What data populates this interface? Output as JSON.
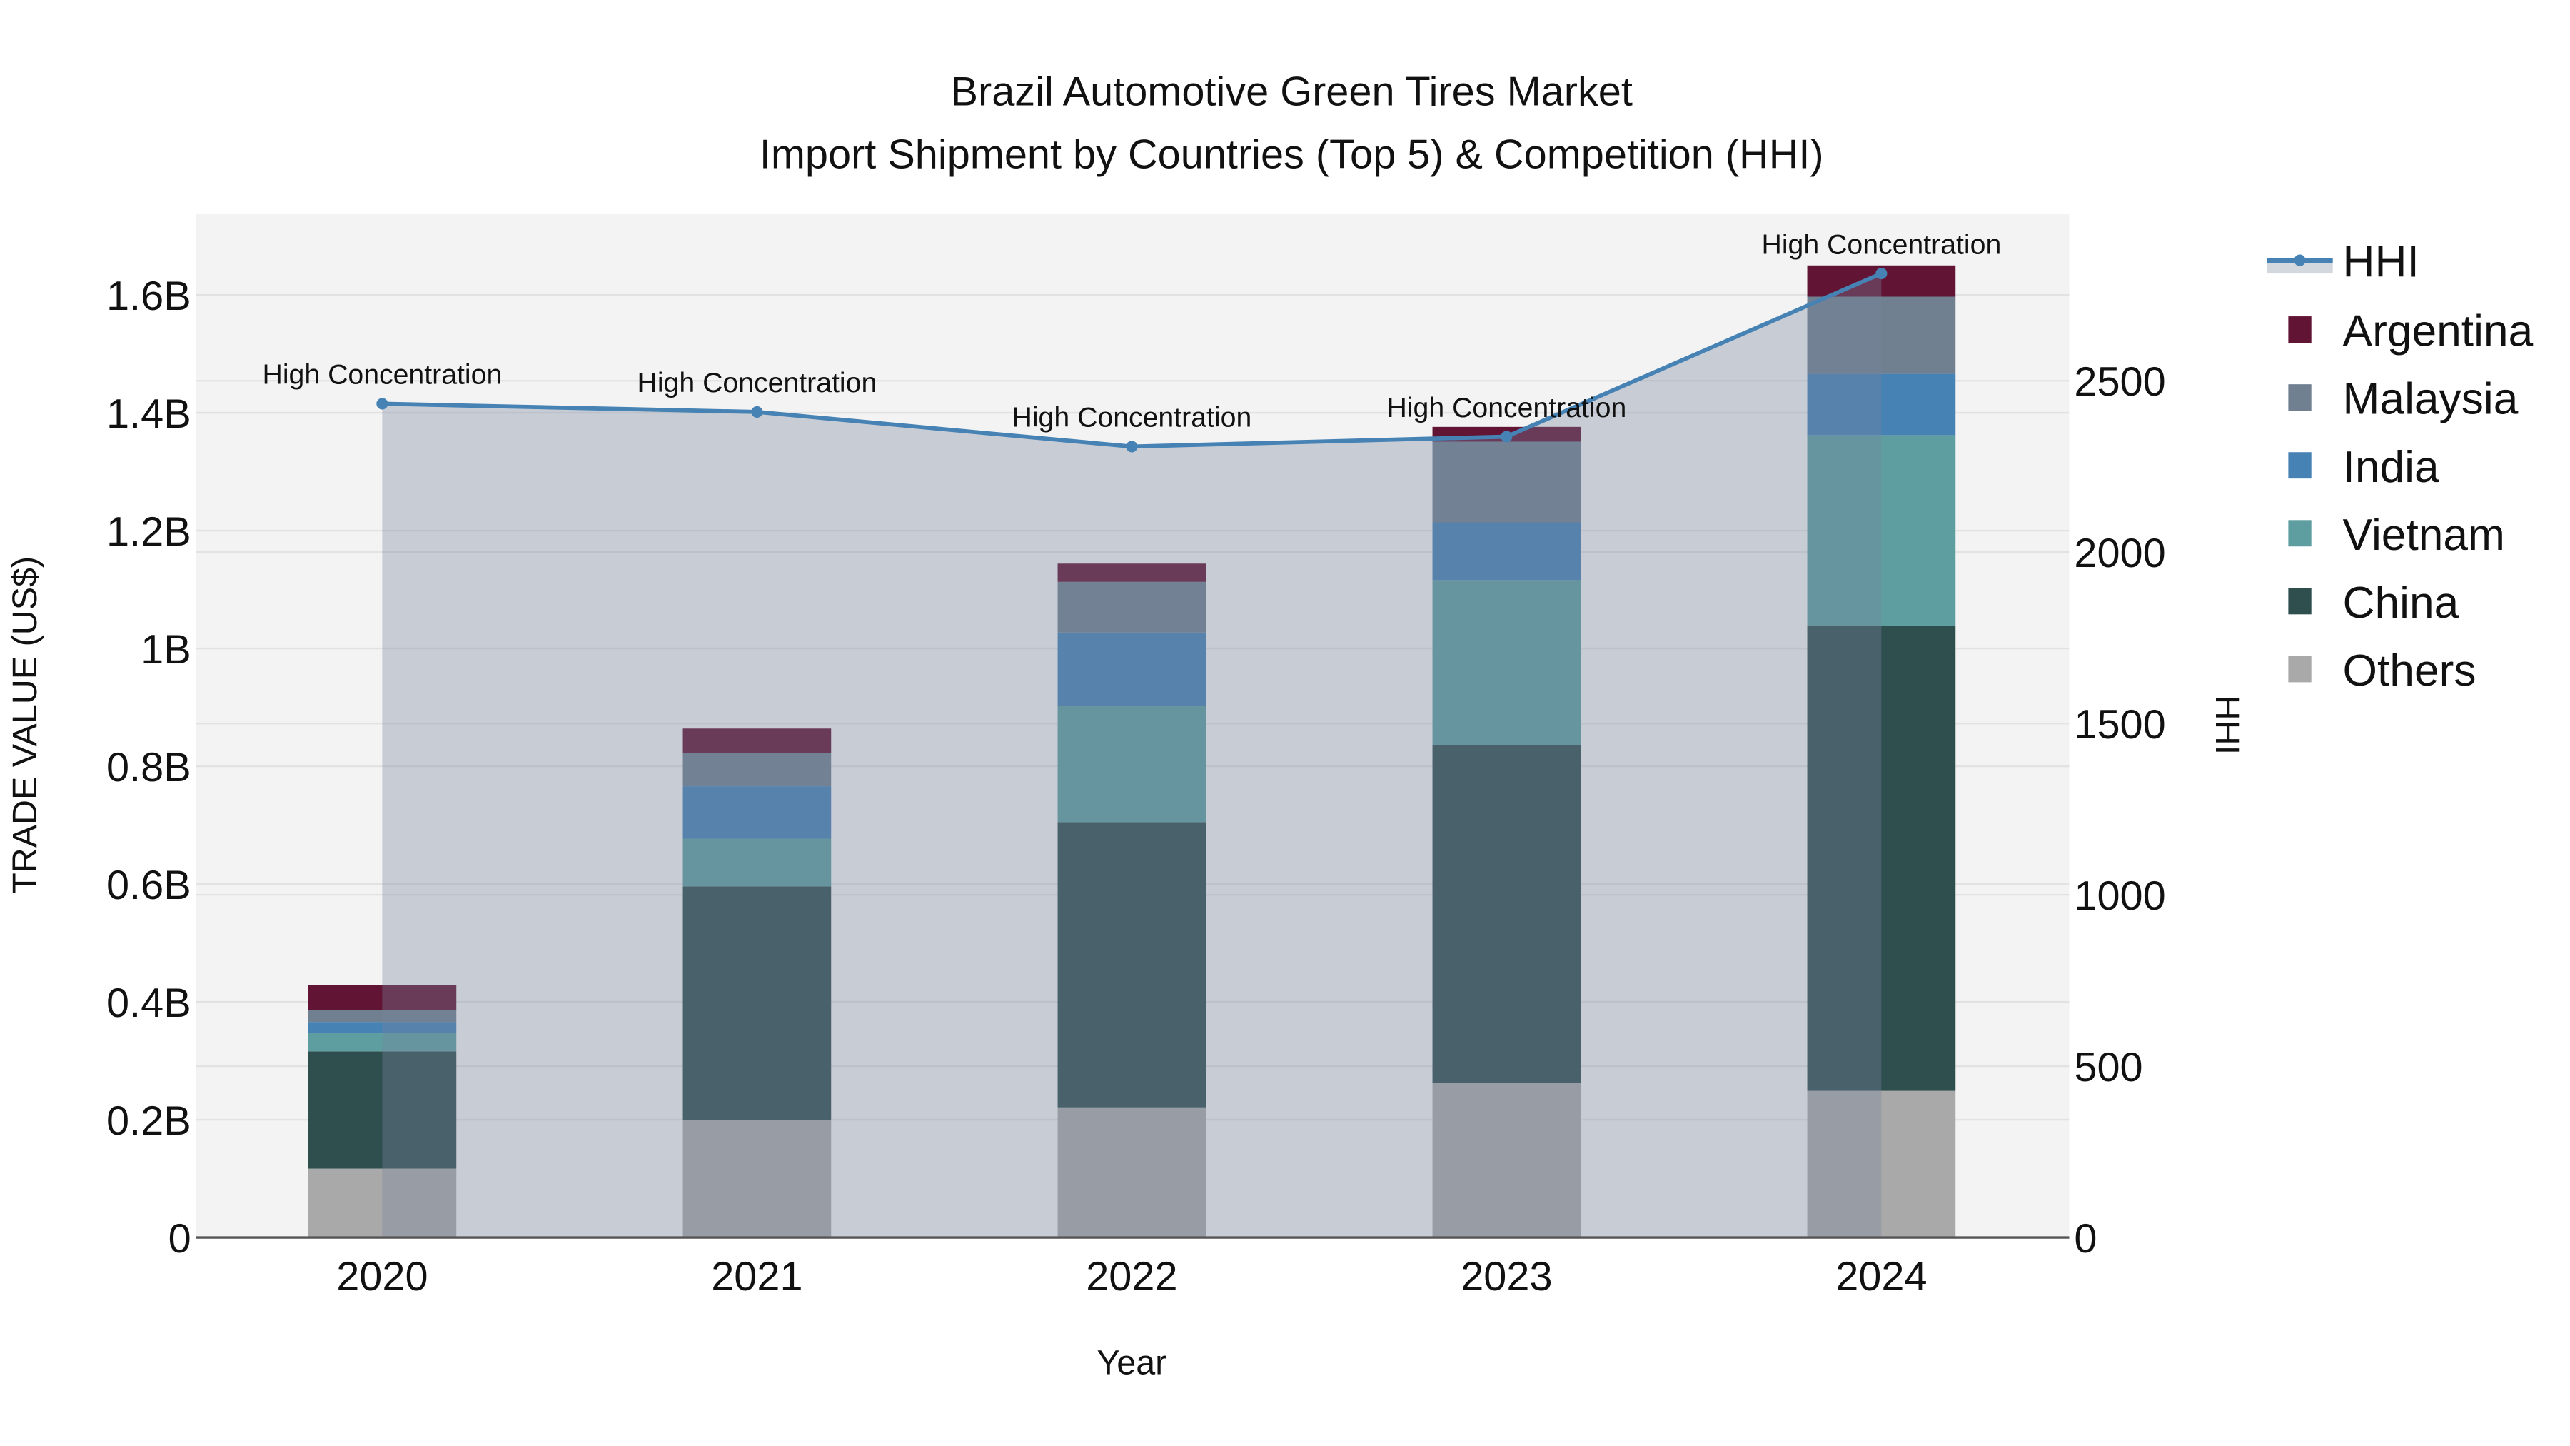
{
  "chart_data": {
    "type": "bar",
    "title_line1": "Brazil Automotive Green Tires Market",
    "title_line2": "Import Shipment by Countries (Top 5) & Competition (HHI)",
    "xlabel": "Year",
    "ylabel": "TRADE VALUE (US$)",
    "y2label": "HHI",
    "categories": [
      "2020",
      "2021",
      "2022",
      "2023",
      "2024"
    ],
    "ylim": [
      0,
      1.737
    ],
    "y_unit": "billion US$",
    "y_ticks": [
      0,
      0.2,
      0.4,
      0.6,
      0.8,
      1.0,
      1.2,
      1.4,
      1.6
    ],
    "y_tick_labels": [
      "0",
      "0.2B",
      "0.4B",
      "0.6B",
      "0.8B",
      "1B",
      "1.2B",
      "1.4B",
      "1.6B"
    ],
    "y2lim": [
      0,
      2986
    ],
    "y2_ticks": [
      0,
      500,
      1000,
      1500,
      2000,
      2500
    ],
    "y2_tick_labels": [
      "0",
      "500",
      "1000",
      "1500",
      "2000",
      "2500"
    ],
    "series": [
      {
        "name": "Others",
        "color": "#a9a9a9",
        "values": [
          0.117,
          0.199,
          0.221,
          0.263,
          0.249
        ]
      },
      {
        "name": "China",
        "color": "#2f4f4f",
        "values": [
          0.199,
          0.397,
          0.484,
          0.573,
          0.789
        ]
      },
      {
        "name": "Vietnam",
        "color": "#5f9ea0",
        "values": [
          0.031,
          0.081,
          0.198,
          0.28,
          0.324
        ]
      },
      {
        "name": "India",
        "color": "#4682b4",
        "values": [
          0.019,
          0.089,
          0.124,
          0.098,
          0.104
        ]
      },
      {
        "name": "Malaysia",
        "color": "#708090",
        "values": [
          0.02,
          0.056,
          0.086,
          0.137,
          0.131
        ]
      },
      {
        "name": "Argentina",
        "color": "#611434",
        "values": [
          0.042,
          0.042,
          0.031,
          0.025,
          0.053
        ]
      }
    ],
    "hhi": {
      "name": "HHI",
      "color": "#4682b4",
      "values": [
        2433,
        2409,
        2308,
        2337,
        2813
      ],
      "annotations": [
        "High Concentration",
        "High Concentration",
        "High Concentration",
        "High Concentration",
        "High Concentration"
      ]
    },
    "legend_order": [
      "HHI",
      "Argentina",
      "Malaysia",
      "India",
      "Vietnam",
      "China",
      "Others"
    ],
    "legend_placement": "right",
    "grid": true
  }
}
